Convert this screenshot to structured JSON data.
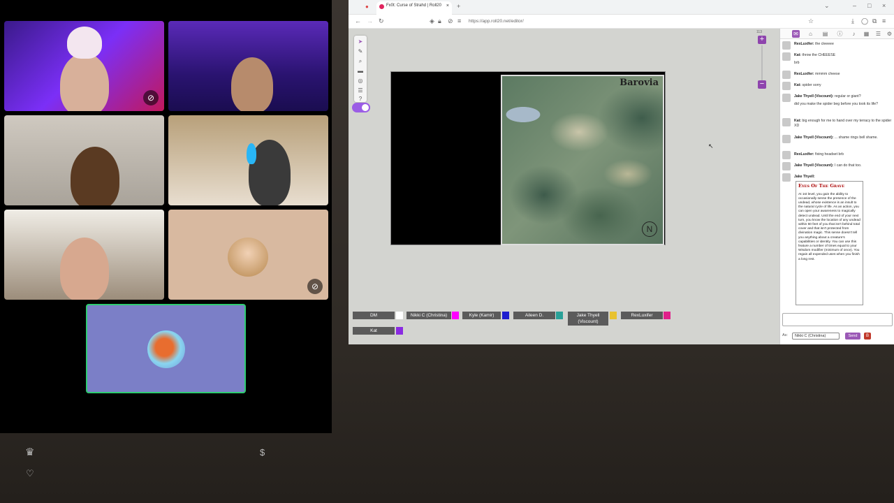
{
  "browser": {
    "tab_title": "Fx0t: Curse of Strahd | Roll20",
    "tab_subtitle": "Roll20",
    "url": "https://app.roll20.net/editor/",
    "new_tab": "+"
  },
  "map": {
    "title": "Barovia",
    "compass": "N"
  },
  "zoom": {
    "level": "113",
    "plus": "+",
    "minus": "−"
  },
  "players": [
    {
      "name": "DM",
      "color": "#ffffff"
    },
    {
      "name": "Nikki C (Christina)",
      "color": "#ff00ff"
    },
    {
      "name": "Kyle (Kamir)",
      "color": "#1f1fcf"
    },
    {
      "name": "Aileen D.",
      "color": "#2aa198"
    },
    {
      "name": "Jake Thyell (Viscount)",
      "color": "#e8c22f"
    },
    {
      "name": "RexLuxifer",
      "color": "#e0208a"
    },
    {
      "name": "Kat",
      "color": "#8a2be2"
    }
  ],
  "chat": {
    "messages": [
      {
        "who": "RexLuxifer:",
        "text": "the cleeeee"
      },
      {
        "who": "Kat:",
        "text": "throw the CHEEESE"
      },
      {
        "who": "",
        "text": "brb"
      },
      {
        "who": "RexLuxifer:",
        "text": "mmmm cheese"
      },
      {
        "who": "Kat:",
        "text": "spider sorry"
      },
      {
        "who": "Jake Thyell (Viscount):",
        "text": "regular or giant?"
      },
      {
        "who": "",
        "text": "did you make the spider beg before you took its life?"
      },
      {
        "who": "Kat:",
        "text": "big enough for me to hand over my terracy to the spider XD"
      },
      {
        "who": "Jake Thyell (Viscount):",
        "text": "... shame rings bell shame."
      },
      {
        "who": "RexLuxifer:",
        "text": "fixing headset brb"
      },
      {
        "who": "Jake Thyell (Viscount):",
        "text": "I can do that too."
      },
      {
        "who": "Jake Thyell:",
        "text": ""
      }
    ],
    "card_title": "Eyes Of The Grave",
    "card_text": "At 1st level, you gain the ability to occasionally sense the presence of the undead, whose existence is an insult to the natural cycle of life. As an action, you can open your awareness to magically detect undead. Until the end of your next turn, you know the location of any undead within 60 feet of you that isn't behind total cover and that isn't protected from divination magic. This sense doesn't tell you anything about a creature's capabilities or identity. You can use this feature a number of times equal to your Wisdom modifier (minimum of once). You regain all expended uses when you finish a long rest.",
    "as_label": "As:",
    "as_value": "Nikki C (Christina)",
    "send_label": "Send",
    "dice_label": "B"
  },
  "overlay": {
    "crown": "♛",
    "dollar": "$",
    "heart": "♡"
  }
}
